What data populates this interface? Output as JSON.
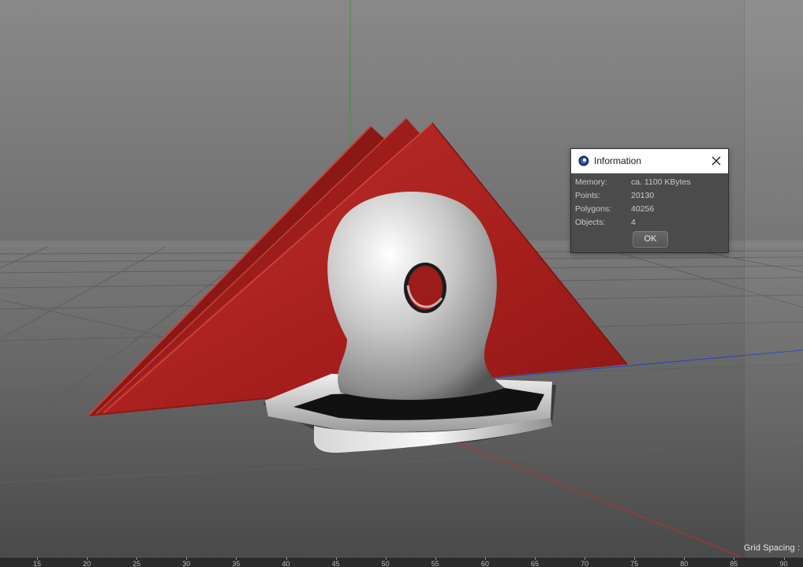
{
  "dialog": {
    "title": "Information",
    "app_icon": "cinema4d-logo-icon",
    "close_icon": "close-icon",
    "rows": [
      {
        "label": "Memory:",
        "value": "ca. 1100 KBytes"
      },
      {
        "label": "Points:",
        "value": "20130"
      },
      {
        "label": "Polygons:",
        "value": "40256"
      },
      {
        "label": "Objects:",
        "value": "4"
      }
    ],
    "ok_label": "OK"
  },
  "viewport": {
    "grid_spacing_label": "Grid Spacing :",
    "ruler_ticks": [
      "15",
      "20",
      "25",
      "30",
      "35",
      "40",
      "45",
      "50",
      "55",
      "60",
      "65",
      "70",
      "75",
      "80",
      "85",
      "90"
    ]
  },
  "colors": {
    "napkin": "#a8201e",
    "holder": "#c8c8c8",
    "background": "#4e4e4e",
    "axis_x": "#c0302a",
    "axis_y": "#2f9a3a",
    "axis_z": "#2a3fc8"
  }
}
